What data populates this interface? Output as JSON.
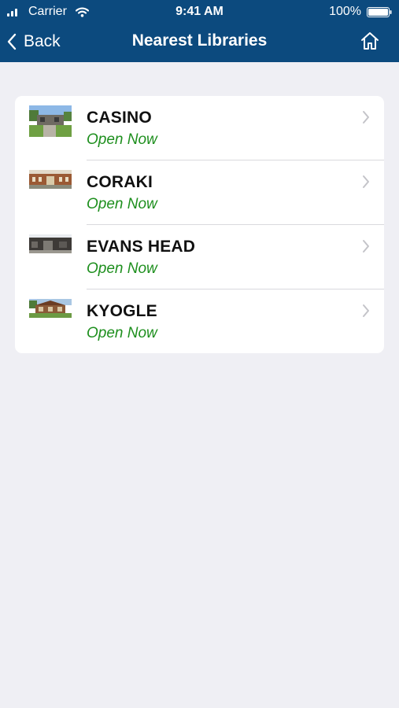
{
  "status_bar": {
    "carrier": "Carrier",
    "time": "9:41 AM",
    "battery": "100%",
    "signal_icon": "signal-bars-icon",
    "wifi_icon": "wifi-icon",
    "battery_icon": "battery-icon"
  },
  "nav": {
    "back_label": "Back",
    "title": "Nearest Libraries",
    "back_icon": "chevron-left-icon",
    "home_icon": "home-icon"
  },
  "colors": {
    "header_bg": "#0c4a7e",
    "page_bg": "#efeff4",
    "open_status": "#1e8f1e",
    "chevron": "#c4c4c9"
  },
  "libraries": [
    {
      "name": "CASINO",
      "status": "Open Now",
      "image": "library-photo-casino"
    },
    {
      "name": "CORAKI",
      "status": "Open Now",
      "image": "library-photo-coraki"
    },
    {
      "name": "EVANS HEAD",
      "status": "Open Now",
      "image": "library-photo-evans-head"
    },
    {
      "name": "KYOGLE",
      "status": "Open Now",
      "image": "library-photo-kyogle"
    }
  ]
}
